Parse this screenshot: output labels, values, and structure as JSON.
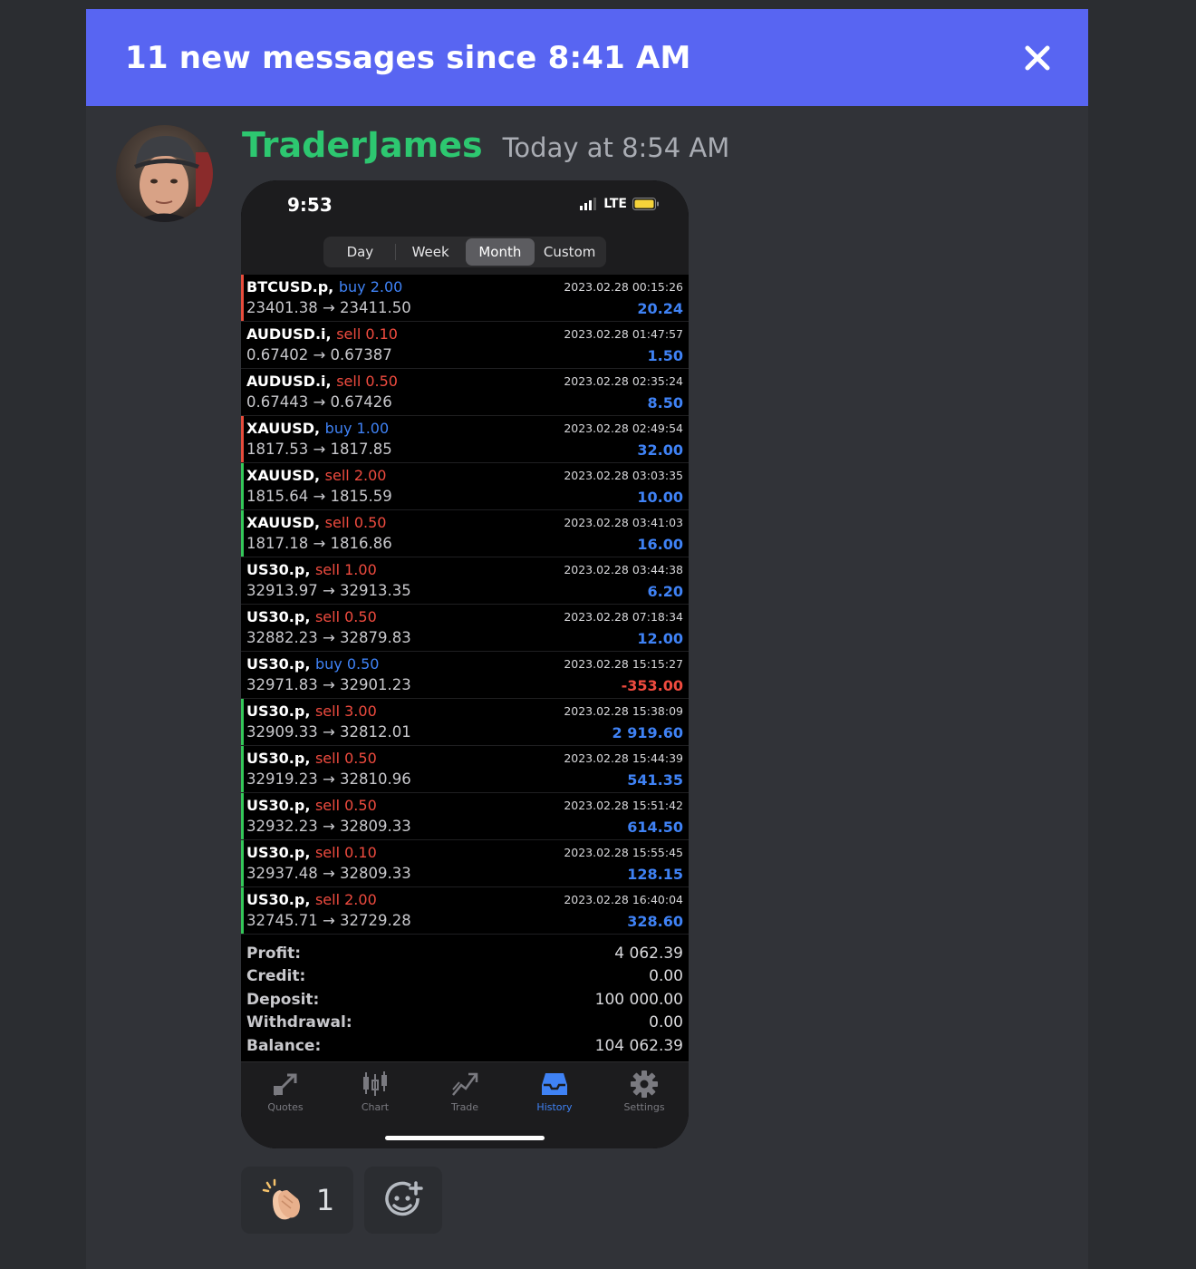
{
  "banner": {
    "text": "11 new messages since 8:41 AM"
  },
  "message": {
    "username": "TraderJames",
    "timestamp": "Today at 8:54 AM"
  },
  "phone": {
    "time": "9:53",
    "network": "LTE",
    "segments": [
      {
        "label": "Day",
        "active": false
      },
      {
        "label": "Week",
        "active": false
      },
      {
        "label": "Month",
        "active": true
      },
      {
        "label": "Custom",
        "active": false
      }
    ],
    "trades": [
      {
        "symbol": "BTCUSD.p,",
        "side": "buy",
        "lot": "buy 2.00",
        "prices": "23401.38 → 23411.50",
        "date": "2023.02.28 00:15:26",
        "profit": "20.24",
        "bar": "red"
      },
      {
        "symbol": "AUDUSD.i,",
        "side": "sell",
        "lot": "sell 0.10",
        "prices": "0.67402 → 0.67387",
        "date": "2023.02.28 01:47:57",
        "profit": "1.50",
        "bar": "none"
      },
      {
        "symbol": "AUDUSD.i,",
        "side": "sell",
        "lot": "sell 0.50",
        "prices": "0.67443 → 0.67426",
        "date": "2023.02.28 02:35:24",
        "profit": "8.50",
        "bar": "none"
      },
      {
        "symbol": "XAUUSD,",
        "side": "buy",
        "lot": "buy 1.00",
        "prices": "1817.53 → 1817.85",
        "date": "2023.02.28 02:49:54",
        "profit": "32.00",
        "bar": "red"
      },
      {
        "symbol": "XAUUSD,",
        "side": "sell",
        "lot": "sell 2.00",
        "prices": "1815.64 → 1815.59",
        "date": "2023.02.28 03:03:35",
        "profit": "10.00",
        "bar": "green"
      },
      {
        "symbol": "XAUUSD,",
        "side": "sell",
        "lot": "sell 0.50",
        "prices": "1817.18 → 1816.86",
        "date": "2023.02.28 03:41:03",
        "profit": "16.00",
        "bar": "green"
      },
      {
        "symbol": "US30.p,",
        "side": "sell",
        "lot": "sell 1.00",
        "prices": "32913.97 → 32913.35",
        "date": "2023.02.28 03:44:38",
        "profit": "6.20",
        "bar": "none"
      },
      {
        "symbol": "US30.p,",
        "side": "sell",
        "lot": "sell 0.50",
        "prices": "32882.23 → 32879.83",
        "date": "2023.02.28 07:18:34",
        "profit": "12.00",
        "bar": "none"
      },
      {
        "symbol": "US30.p,",
        "side": "buy",
        "lot": "buy 0.50",
        "prices": "32971.83 → 32901.23",
        "date": "2023.02.28 15:15:27",
        "profit": "-353.00",
        "bar": "none"
      },
      {
        "symbol": "US30.p,",
        "side": "sell",
        "lot": "sell 3.00",
        "prices": "32909.33 → 32812.01",
        "date": "2023.02.28 15:38:09",
        "profit": "2 919.60",
        "bar": "green"
      },
      {
        "symbol": "US30.p,",
        "side": "sell",
        "lot": "sell 0.50",
        "prices": "32919.23 → 32810.96",
        "date": "2023.02.28 15:44:39",
        "profit": "541.35",
        "bar": "green"
      },
      {
        "symbol": "US30.p,",
        "side": "sell",
        "lot": "sell 0.50",
        "prices": "32932.23 → 32809.33",
        "date": "2023.02.28 15:51:42",
        "profit": "614.50",
        "bar": "green"
      },
      {
        "symbol": "US30.p,",
        "side": "sell",
        "lot": "sell 0.10",
        "prices": "32937.48 → 32809.33",
        "date": "2023.02.28 15:55:45",
        "profit": "128.15",
        "bar": "green"
      },
      {
        "symbol": "US30.p,",
        "side": "sell",
        "lot": "sell 2.00",
        "prices": "32745.71 → 32729.28",
        "date": "2023.02.28 16:40:04",
        "profit": "328.60",
        "bar": "green"
      }
    ],
    "summary": [
      {
        "label": "Profit:",
        "value": "4 062.39"
      },
      {
        "label": "Credit:",
        "value": "0.00"
      },
      {
        "label": "Deposit:",
        "value": "100 000.00"
      },
      {
        "label": "Withdrawal:",
        "value": "0.00"
      },
      {
        "label": "Balance:",
        "value": "104 062.39"
      }
    ],
    "tabs": [
      {
        "label": "Quotes",
        "icon": "quotes-icon",
        "active": false
      },
      {
        "label": "Chart",
        "icon": "chart-icon",
        "active": false
      },
      {
        "label": "Trade",
        "icon": "trade-icon",
        "active": false
      },
      {
        "label": "History",
        "icon": "history-icon",
        "active": true
      },
      {
        "label": "Settings",
        "icon": "settings-icon",
        "active": false
      }
    ]
  },
  "reactions": {
    "clap_count": "1"
  },
  "colors": {
    "blurple": "#5865f2",
    "username": "#2dc770",
    "buy": "#3f82f5",
    "sell": "#ef4b3f",
    "bar_green": "#34c759",
    "bar_red": "#e74c3c"
  }
}
